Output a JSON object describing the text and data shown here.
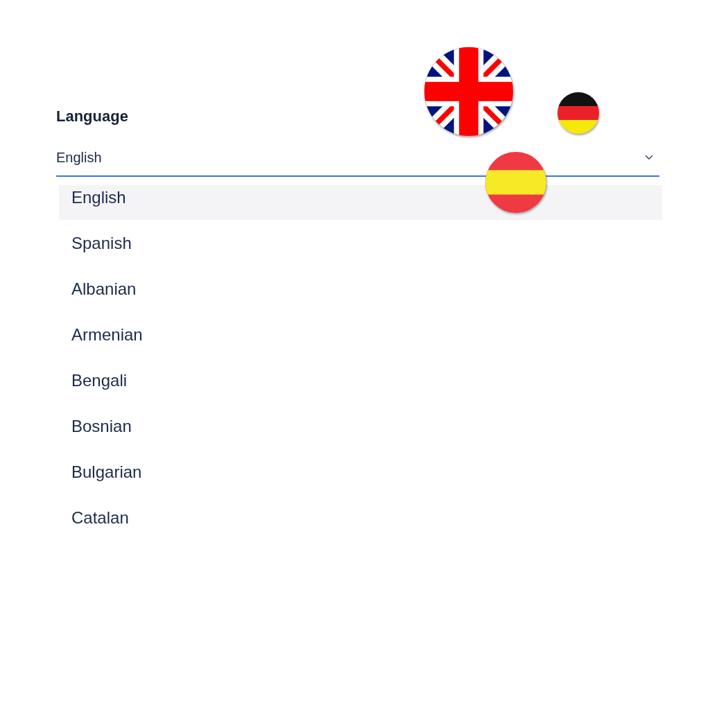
{
  "field": {
    "label": "Language",
    "value": "English",
    "expanded": true
  },
  "options": [
    {
      "label": "English",
      "selected": true
    },
    {
      "label": "Spanish",
      "selected": false
    },
    {
      "label": "Albanian",
      "selected": false
    },
    {
      "label": "Armenian",
      "selected": false
    },
    {
      "label": "Bengali",
      "selected": false
    },
    {
      "label": "Bosnian",
      "selected": false
    },
    {
      "label": "Bulgarian",
      "selected": false
    },
    {
      "label": "Catalan",
      "selected": false
    }
  ]
}
